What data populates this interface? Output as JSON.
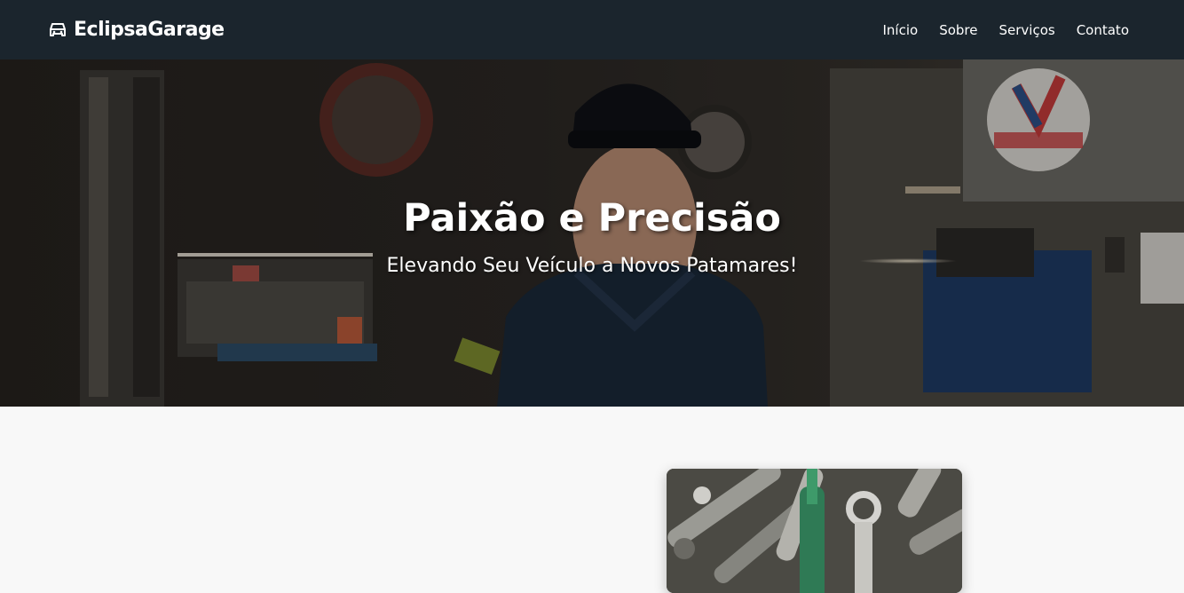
{
  "navbar": {
    "brand": "EclipsaGarage",
    "brand_icon": "car-icon",
    "links": [
      "Início",
      "Sobre",
      "Serviços",
      "Contato"
    ],
    "background": "#1b252d"
  },
  "hero": {
    "title": "Paixão e Precisão",
    "subtitle": "Elevando Seu Veículo a Novos Patamares!",
    "image": "mechanic-in-garage-photo"
  },
  "content": {
    "card_image": "tools-photo"
  }
}
